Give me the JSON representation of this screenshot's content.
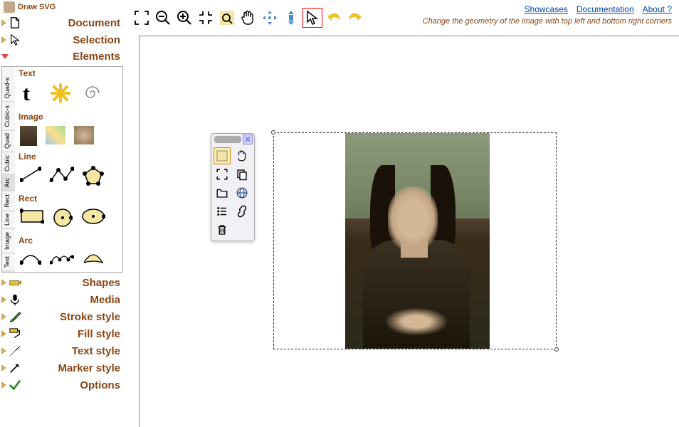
{
  "header": {
    "title": "Draw SVG"
  },
  "topLinks": {
    "showcases": "Showcases",
    "documentation": "Documentation",
    "about": "About ?"
  },
  "hint": "Change the geometry of the image with top left and bottom right corners",
  "menu": {
    "document": "Document",
    "selection": "Selection",
    "elements": "Elements",
    "shapes": "Shapes",
    "media": "Media",
    "stroke": "Stroke style",
    "fill": "Fill style",
    "text": "Text style",
    "marker": "Marker style",
    "options": "Options"
  },
  "vertTabs": [
    "Text",
    "Image",
    "Line",
    "Rect",
    "Arc",
    "Cubic",
    "Quad",
    "Cubic-s",
    "Quad-s"
  ],
  "elemSections": {
    "text": "Text",
    "image": "Image",
    "line": "Line",
    "rect": "Rect",
    "arc": "Arc"
  }
}
